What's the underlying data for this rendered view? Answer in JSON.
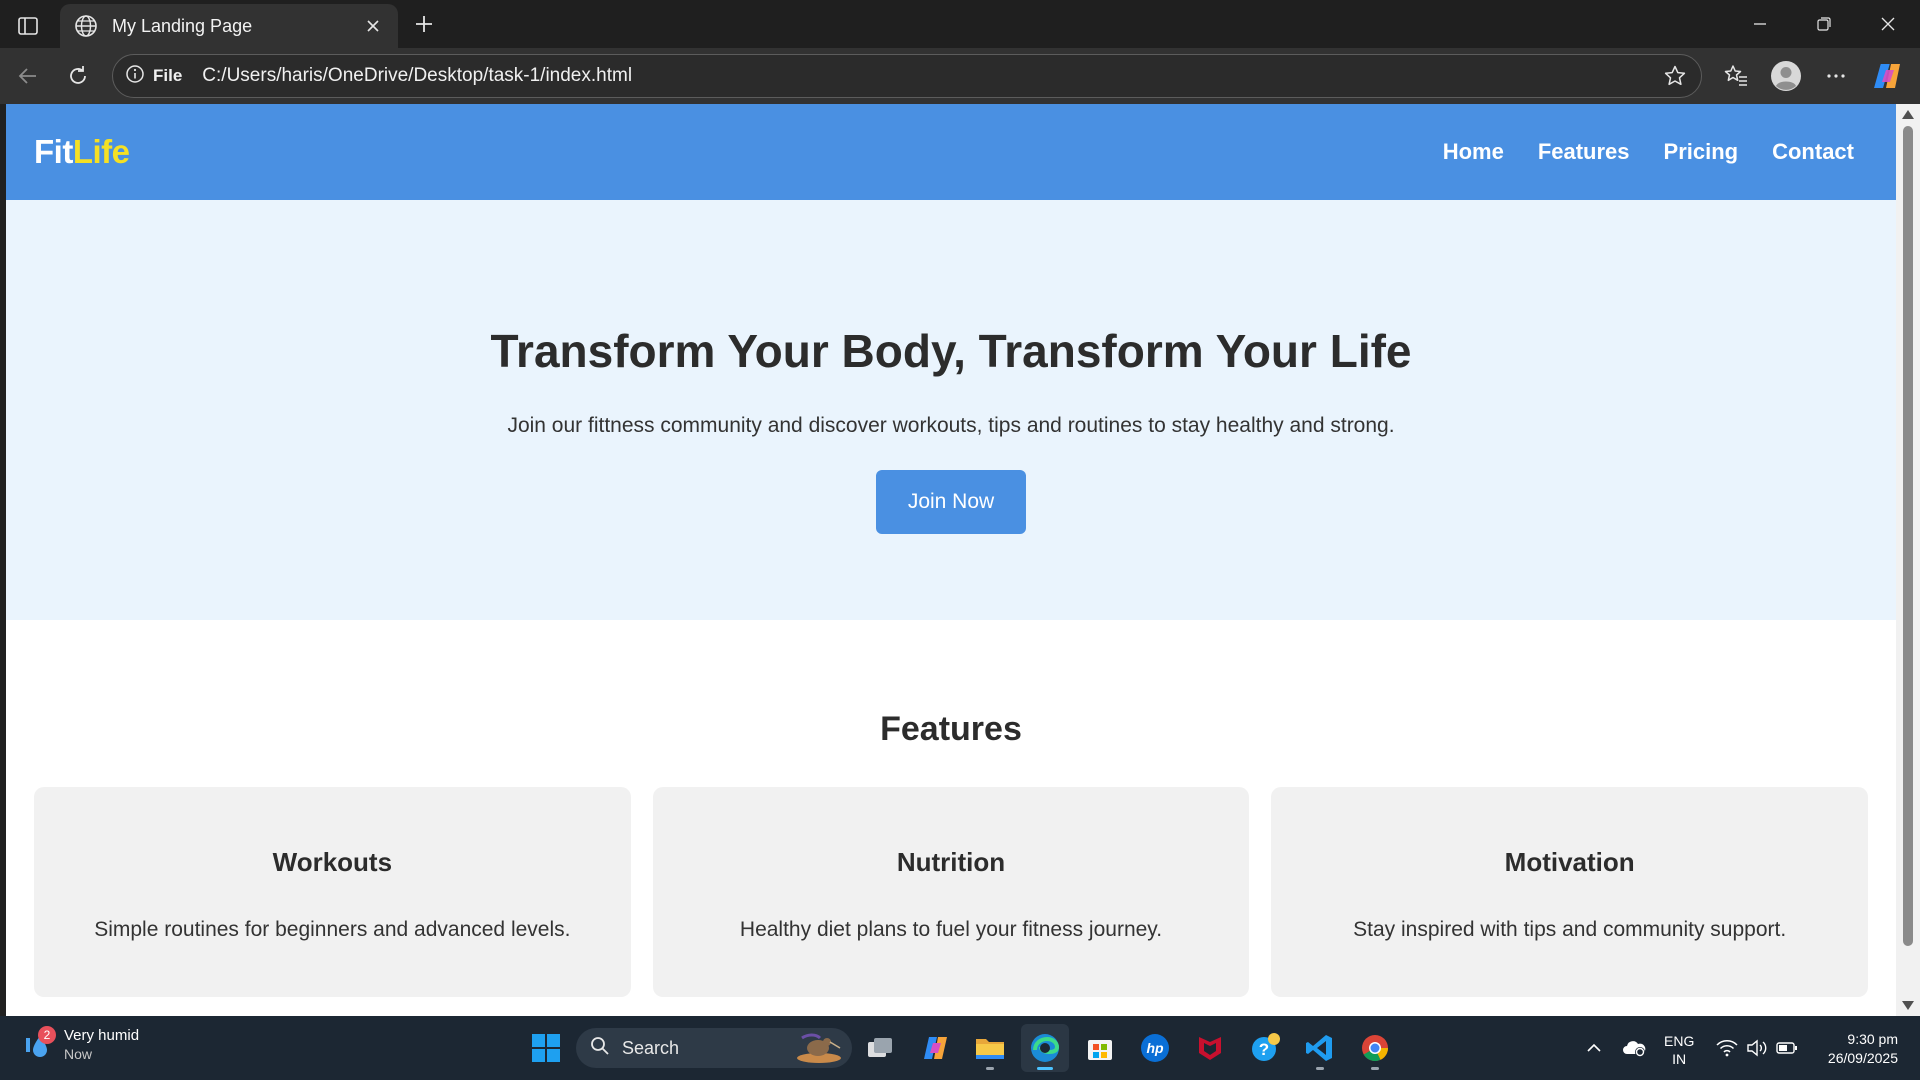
{
  "browser": {
    "tab_title": "My Landing Page",
    "site_label": "File",
    "url": "C:/Users/haris/OneDrive/Desktop/task-1/index.html"
  },
  "site": {
    "logo_part1": "Fit",
    "logo_part2": "Life",
    "nav": [
      "Home",
      "Features",
      "Pricing",
      "Contact"
    ],
    "hero": {
      "title": "Transform Your Body, Transform Your Life",
      "subtitle": "Join our fittness community and discover workouts, tips and routines to stay healthy and strong.",
      "cta": "Join Now"
    },
    "features": {
      "heading": "Features",
      "cards": [
        {
          "title": "Workouts",
          "text": "Simple routines for beginners and advanced levels."
        },
        {
          "title": "Nutrition",
          "text": "Healthy diet plans to fuel your fitness journey."
        },
        {
          "title": "Motivation",
          "text": "Stay inspired with tips and community support."
        }
      ]
    }
  },
  "colors": {
    "header_bg": "#4a90e2",
    "logo_accent": "#f5e024",
    "hero_bg": "#eaf4fd",
    "card_bg": "#f1f1f1"
  },
  "taskbar": {
    "weather_title": "Very humid",
    "weather_sub": "Now",
    "weather_badge": "2",
    "search_label": "Search",
    "apps": [
      "task-view-icon",
      "copilot-icon",
      "file-explorer-icon",
      "edge-icon",
      "microsoft-store-icon",
      "hp-icon",
      "mcafee-icon",
      "get-help-icon",
      "vscode-icon",
      "chrome-icon"
    ],
    "lang_line1": "ENG",
    "lang_line2": "IN",
    "time": "9:30 pm",
    "date": "26/09/2025"
  }
}
